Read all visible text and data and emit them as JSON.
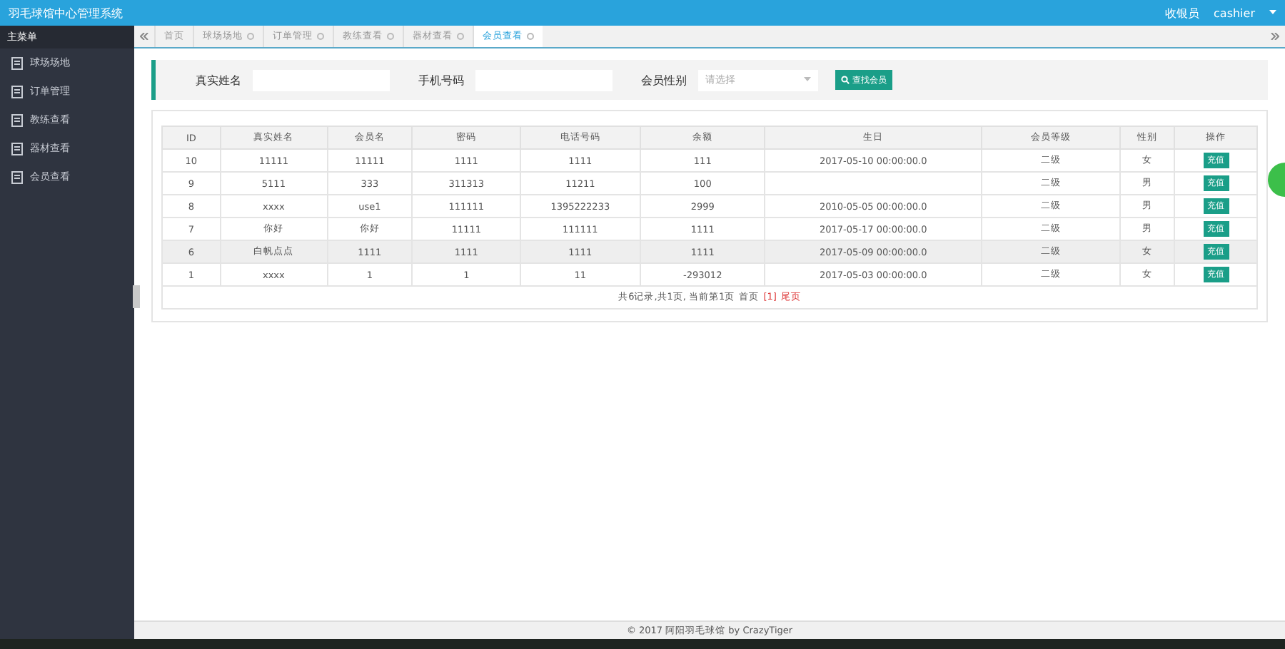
{
  "header": {
    "title": "羽毛球馆中心管理系统",
    "role": "收银员",
    "user": "cashier"
  },
  "sidebar": {
    "title": "主菜单",
    "items": [
      {
        "label": "球场场地",
        "selected": false
      },
      {
        "label": "订单管理",
        "selected": false
      },
      {
        "label": "教练查看",
        "selected": false
      },
      {
        "label": "器材查看",
        "selected": false
      },
      {
        "label": "会员查看",
        "selected": false
      }
    ]
  },
  "tabs": [
    {
      "label": "首页",
      "closable": false,
      "selected": false
    },
    {
      "label": "球场场地",
      "closable": true,
      "selected": false
    },
    {
      "label": "订单管理",
      "closable": true,
      "selected": false
    },
    {
      "label": "教练查看",
      "closable": true,
      "selected": false
    },
    {
      "label": "器材查看",
      "closable": true,
      "selected": false
    },
    {
      "label": "会员查看",
      "closable": true,
      "selected": true
    }
  ],
  "search": {
    "fields": [
      {
        "label": "真实姓名",
        "kind": "text"
      },
      {
        "label": "手机号码",
        "kind": "text"
      },
      {
        "label": "会员性别",
        "kind": "select",
        "placeholder": "请选择"
      }
    ],
    "button": "查找会员"
  },
  "table": {
    "columns": [
      "ID",
      "真实姓名",
      "会员名",
      "密码",
      "电话号码",
      "余额",
      "生日",
      "会员等级",
      "性别",
      "操作"
    ],
    "rows": [
      {
        "cells": [
          "10",
          "11111",
          "11111",
          "1111",
          "1111",
          "111",
          "2017-05-10 00:00:00.0",
          "二级",
          "女"
        ],
        "action": "充值",
        "selected": false
      },
      {
        "cells": [
          "9",
          "5111",
          "333",
          "311313",
          "11211",
          "100",
          "",
          "二级",
          "男"
        ],
        "action": "充值",
        "selected": false
      },
      {
        "cells": [
          "8",
          "xxxx",
          "use1",
          "111111",
          "1395222233",
          "2999",
          "2010-05-05 00:00:00.0",
          "二级",
          "男"
        ],
        "action": "充值",
        "selected": false
      },
      {
        "cells": [
          "7",
          "你好",
          "你好",
          "11111",
          "111111",
          "1111",
          "2017-05-17 00:00:00.0",
          "二级",
          "男"
        ],
        "action": "充值",
        "selected": false
      },
      {
        "cells": [
          "6",
          "白帆点点",
          "1111",
          "1111",
          "1111",
          "1111",
          "2017-05-09 00:00:00.0",
          "二级",
          "女"
        ],
        "action": "充值",
        "selected": true
      },
      {
        "cells": [
          "1",
          "xxxx",
          "1",
          "1",
          "11",
          "-293012",
          "2017-05-03 00:00:00.0",
          "二级",
          "女"
        ],
        "action": "充值",
        "selected": false
      }
    ],
    "pager": {
      "summary": "共6记录,共1页, 当前第1页",
      "first": "首页",
      "current": "[1]",
      "last": "尾页"
    }
  },
  "footer": "© 2017 阿阳羽毛球馆 by CrazyTiger"
}
